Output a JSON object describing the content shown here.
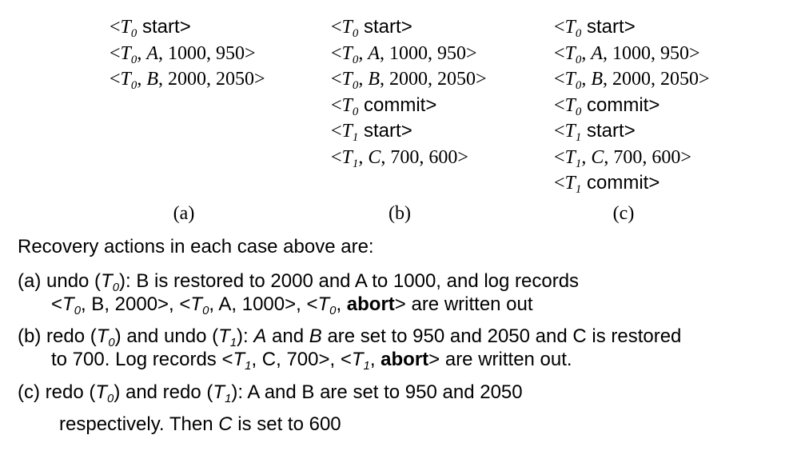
{
  "columns": [
    {
      "id": "a",
      "lines": [
        {
          "tx": "0",
          "kind": "start"
        },
        {
          "tx": "0",
          "kind": "update",
          "item": "A",
          "old": "1000",
          "new": "950"
        },
        {
          "tx": "0",
          "kind": "update",
          "item": "B",
          "old": "2000",
          "new": "2050"
        }
      ],
      "caption": "(a)"
    },
    {
      "id": "b",
      "lines": [
        {
          "tx": "0",
          "kind": "start"
        },
        {
          "tx": "0",
          "kind": "update",
          "item": "A",
          "old": "1000",
          "new": "950"
        },
        {
          "tx": "0",
          "kind": "update",
          "item": "B",
          "old": "2000",
          "new": "2050"
        },
        {
          "tx": "0",
          "kind": "commit"
        },
        {
          "tx": "1",
          "kind": "start"
        },
        {
          "tx": "1",
          "kind": "update",
          "item": "C",
          "old": "700",
          "new": "600"
        }
      ],
      "caption": "(b)"
    },
    {
      "id": "c",
      "lines": [
        {
          "tx": "0",
          "kind": "start"
        },
        {
          "tx": "0",
          "kind": "update",
          "item": "A",
          "old": "1000",
          "new": "950"
        },
        {
          "tx": "0",
          "kind": "update",
          "item": "B",
          "old": "2000",
          "new": "2050"
        },
        {
          "tx": "0",
          "kind": "commit"
        },
        {
          "tx": "1",
          "kind": "start"
        },
        {
          "tx": "1",
          "kind": "update",
          "item": "C",
          "old": "700",
          "new": "600"
        },
        {
          "tx": "1",
          "kind": "commit"
        }
      ],
      "caption": "(c)"
    }
  ],
  "labels": {
    "start": "start",
    "commit": "commit"
  },
  "heading": "Recovery actions in each case above are:",
  "case_a": {
    "prefix": "(a)  undo (",
    "tx": "0",
    "rest1": "): B is restored to 2000 and A to 1000, and log records",
    "l2_1": "<",
    "l2_2": ", B, 2000>, <",
    "l2_3": ", A, 1000>, <",
    "l2_4": ", ",
    "abort": "abort",
    "l2_5": "> are written out"
  },
  "case_b": {
    "prefix": "(b) redo (",
    "tx0": "0",
    "mid": ") and undo (",
    "tx1": "1",
    "colon": "): ",
    "A": "A",
    "and": " and ",
    "B": "B",
    "rest1": " are set to 950 and 2050 and C is restored",
    "l2_1": "to 700.  Log records <",
    "l2_2": ", C, 700>, <",
    "l2_3": ", ",
    "abort": "abort",
    "l2_4": "> are written out."
  },
  "case_c": {
    "prefix": "(c)  redo (",
    "tx0": "0",
    "mid": ") and redo (",
    "tx1": "1",
    "rest1": "): A and B are set to 950 and 2050",
    "l2_1": "respectively. Then ",
    "C": "C",
    "l2_2": " is set to 600"
  }
}
